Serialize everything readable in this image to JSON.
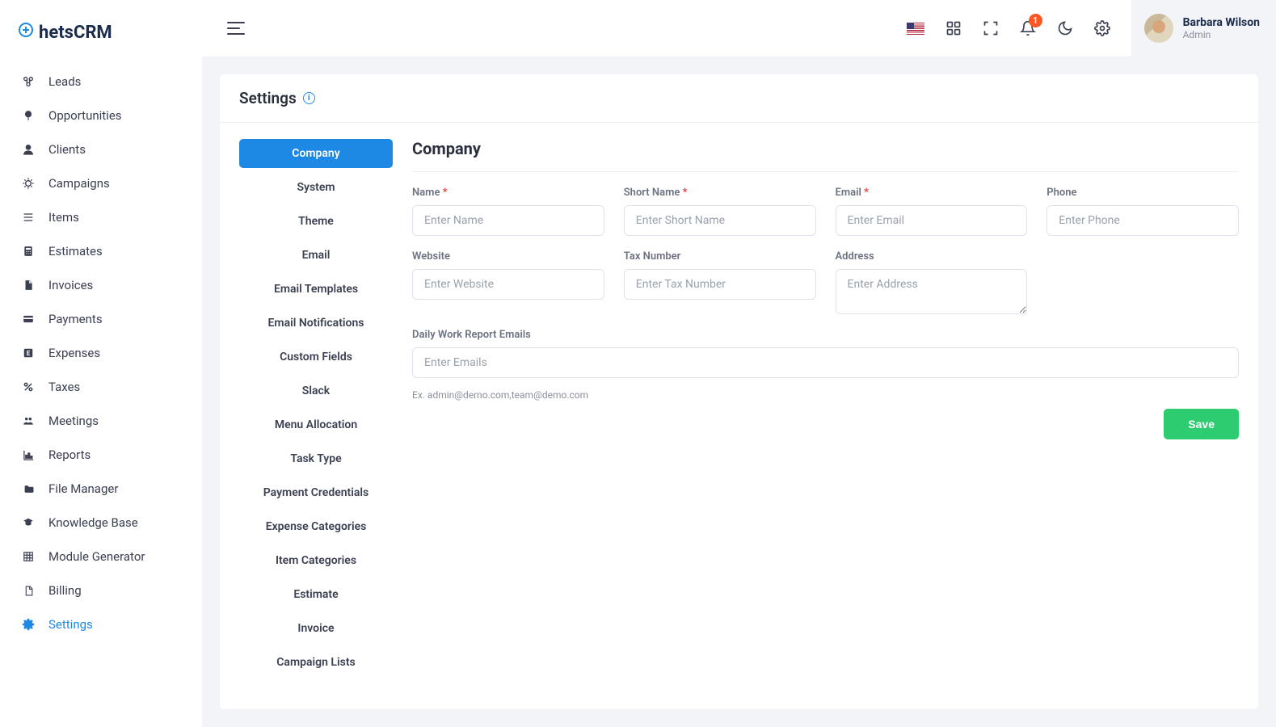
{
  "brand": {
    "name": "hetsCRM"
  },
  "sidebar": {
    "items": [
      {
        "label": "Leads"
      },
      {
        "label": "Opportunities"
      },
      {
        "label": "Clients"
      },
      {
        "label": "Campaigns"
      },
      {
        "label": "Items"
      },
      {
        "label": "Estimates"
      },
      {
        "label": "Invoices"
      },
      {
        "label": "Payments"
      },
      {
        "label": "Expenses"
      },
      {
        "label": "Taxes"
      },
      {
        "label": "Meetings"
      },
      {
        "label": "Reports"
      },
      {
        "label": "File Manager"
      },
      {
        "label": "Knowledge Base"
      },
      {
        "label": "Module Generator"
      },
      {
        "label": "Billing"
      },
      {
        "label": "Settings"
      }
    ]
  },
  "topbar": {
    "notifications_count": "1",
    "user": {
      "name": "Barbara Wilson",
      "role": "Admin"
    }
  },
  "page": {
    "title": "Settings",
    "tabs": [
      "Company",
      "System",
      "Theme",
      "Email",
      "Email Templates",
      "Email Notifications",
      "Custom Fields",
      "Slack",
      "Menu Allocation",
      "Task Type",
      "Payment Credentials",
      "Expense Categories",
      "Item Categories",
      "Estimate",
      "Invoice",
      "Campaign Lists"
    ],
    "section_title": "Company",
    "form": {
      "name": {
        "label": "Name",
        "placeholder": "Enter Name",
        "required": true
      },
      "short_name": {
        "label": "Short Name",
        "placeholder": "Enter Short Name",
        "required": true
      },
      "email": {
        "label": "Email",
        "placeholder": "Enter Email",
        "required": true
      },
      "phone": {
        "label": "Phone",
        "placeholder": "Enter Phone"
      },
      "website": {
        "label": "Website",
        "placeholder": "Enter Website"
      },
      "tax_number": {
        "label": "Tax Number",
        "placeholder": "Enter Tax Number"
      },
      "address": {
        "label": "Address",
        "placeholder": "Enter Address"
      },
      "emails": {
        "label": "Daily Work Report Emails",
        "placeholder": "Enter Emails",
        "hint": "Ex. admin@demo.com,team@demo.com"
      }
    },
    "save_label": "Save"
  }
}
